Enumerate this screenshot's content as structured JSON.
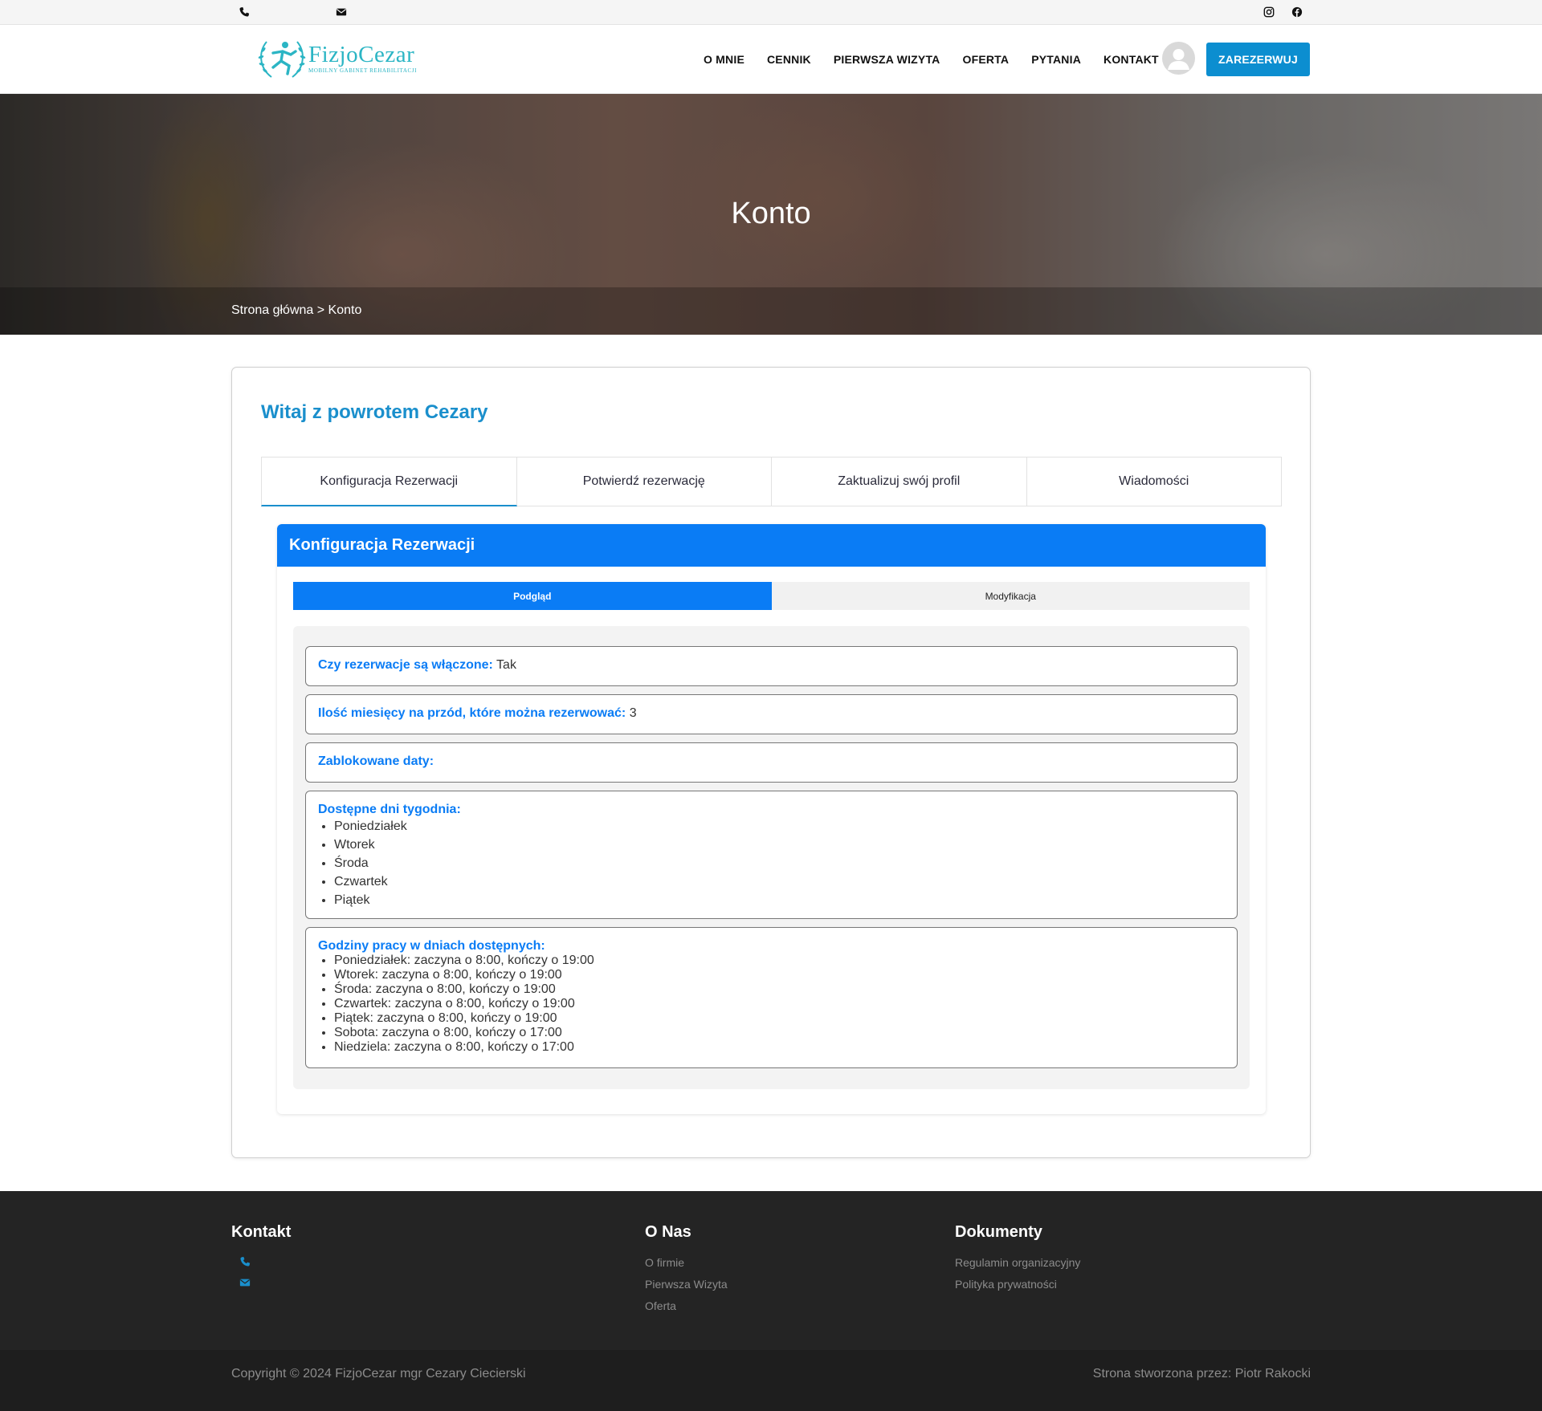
{
  "topbar": {
    "icons": [
      "phone-icon",
      "envelope-icon",
      "instagram-icon",
      "facebook-icon"
    ]
  },
  "brand": {
    "name": "FizjoCezar",
    "tagline": "MOBILNY GABINET REHABILITACJI",
    "color": "#2bb5c4"
  },
  "nav": {
    "items": [
      "O MNIE",
      "CENNIK",
      "PIERWSZA WIZYTA",
      "OFERTA",
      "PYTANIA",
      "KONTAKT"
    ],
    "reserve_label": "ZAREZERWUJ"
  },
  "hero": {
    "title": "Konto",
    "breadcrumb": "Strona główna > Konto"
  },
  "account": {
    "welcome": "Witaj z powrotem Cezary",
    "tabs": [
      "Konfiguracja Rezerwacji",
      "Potwierdź rezerwację",
      "Zaktualizuj swój profil",
      "Wiadomości"
    ],
    "active_tab": 0
  },
  "config": {
    "title": "Konfiguracja Rezerwacji",
    "subtabs": [
      "Podgląd",
      "Modyfikacja"
    ],
    "active_subtab": 0,
    "enabled_label": "Czy rezerwacje są włączone:",
    "enabled_value": "Tak",
    "months_label": "Ilość miesięcy na przód, które można rezerwować:",
    "months_value": "3",
    "blocked_label": "Zablokowane daty:",
    "days_label": "Dostępne dni tygodnia:",
    "days": [
      "Poniedziałek",
      "Wtorek",
      "Środa",
      "Czwartek",
      "Piątek"
    ],
    "hours_label": "Godziny pracy w dniach dostępnych:",
    "hours": [
      "Poniedziałek: zaczyna o 8:00, kończy o 19:00",
      "Wtorek: zaczyna o 8:00, kończy o 19:00",
      "Środa: zaczyna o 8:00, kończy o 19:00",
      "Czwartek: zaczyna o 8:00, kończy o 19:00",
      "Piątek: zaczyna o 8:00, kończy o 19:00",
      "Sobota: zaczyna o 8:00, kończy o 17:00",
      "Niedziela: zaczyna o 8:00, kończy o 17:00"
    ]
  },
  "footer": {
    "contact_title": "Kontakt",
    "about_title": "O Nas",
    "about_links": [
      "O firmie",
      "Pierwsza Wizyta",
      "Oferta"
    ],
    "docs_title": "Dokumenty",
    "docs_links": [
      "Regulamin organizacyjny",
      "Polityka prywatności"
    ],
    "copyright": "Copyright © 2024 FizjoCezar mgr Cezary Ciecierski",
    "made_by": "Strona stworzona przez: Piotr Rakocki"
  },
  "colors": {
    "accent": "#1a8fcc",
    "panel_blue": "#0a7cf5",
    "footer_bg": "#242424"
  }
}
